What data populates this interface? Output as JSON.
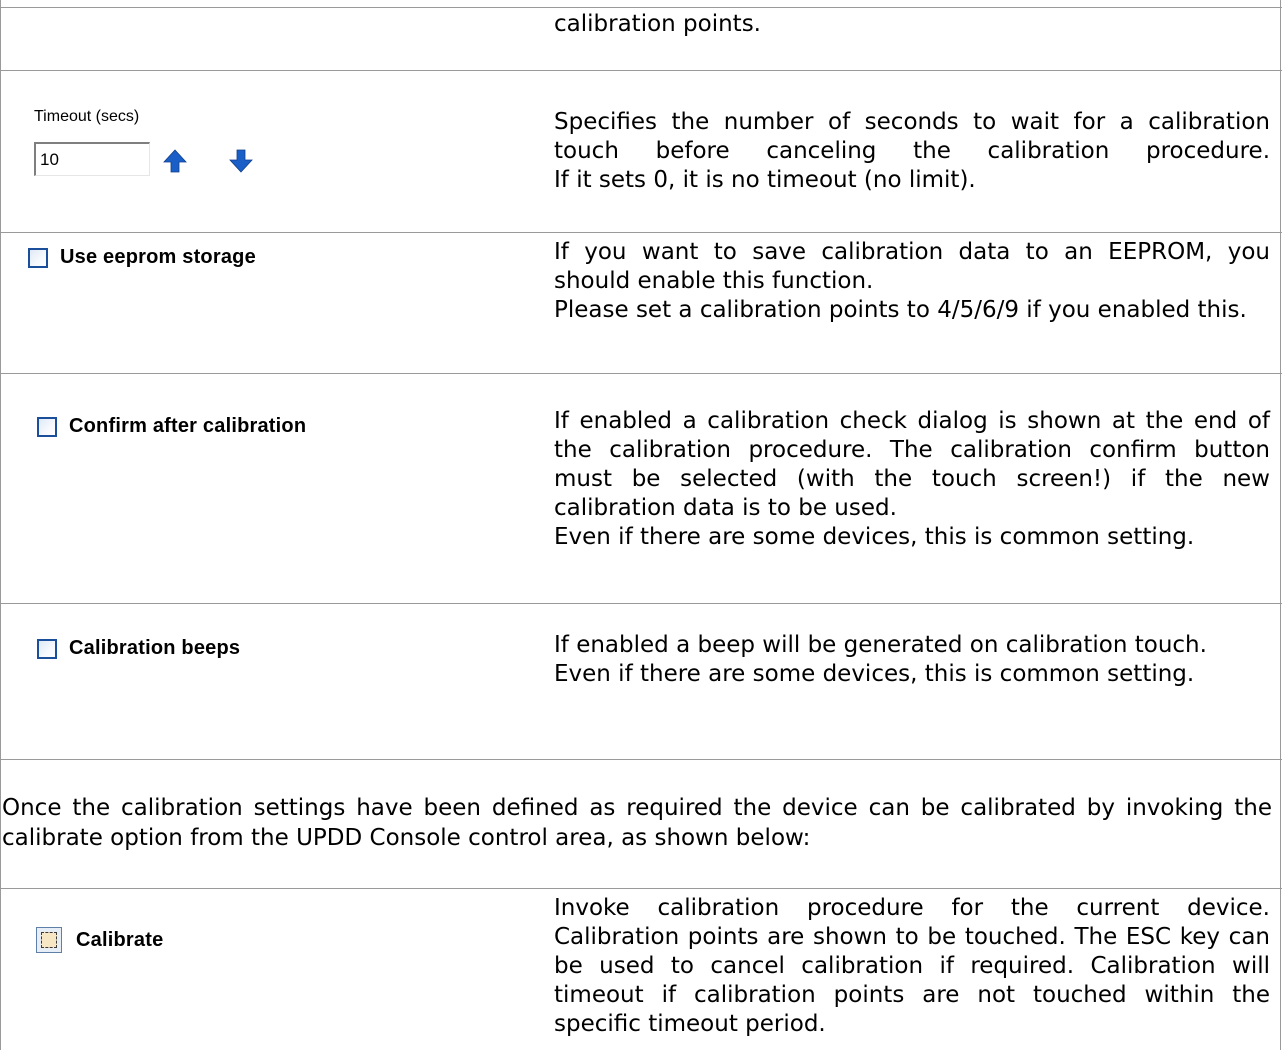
{
  "rows": {
    "top": {
      "description": "calibration points."
    },
    "timeout": {
      "label": "Timeout (secs)",
      "value": "10",
      "up_icon": "arrow-up-icon",
      "down_icon": "arrow-down-icon",
      "description_lines": [
        "Specifies the number of seconds to wait for a calibration touch before canceling the calibration procedure.",
        "If it sets 0, it is no timeout (no limit)."
      ]
    },
    "eeprom": {
      "label": "Use eeprom storage",
      "checked": false,
      "description_lines": [
        "If you want to save calibration data to an EEPROM, you should enable this function.",
        "Please set a calibration points to 4/5/6/9 if you enabled this."
      ]
    },
    "confirm": {
      "label": "Confirm after calibration",
      "checked": false,
      "description_lines": [
        "If enabled a calibration check dialog is shown at the end of the calibration procedure. The calibration confirm button must be selected (with the touch screen!) if the new calibration data is to be used.",
        "Even if there are some devices, this is common setting."
      ]
    },
    "beeps": {
      "label": "Calibration beeps",
      "checked": false,
      "description_lines": [
        "If enabled a beep will be generated on calibration touch.",
        "Even if there are some devices, this is common setting."
      ]
    },
    "intro": {
      "text": "Once the calibration settings have been defined as required the device can be calibrated by invoking the calibrate option from the UPDD Console control area, as shown below:"
    },
    "calibrate": {
      "label": "Calibrate",
      "icon": "calibrate-icon",
      "description": "Invoke calibration procedure for the current device. Calibration points are shown to be touched. The ESC key can be used to cancel calibration if required. Calibration will timeout if calibration points are not touched within the specific timeout period."
    }
  },
  "colors": {
    "rule": "#9a9a9a",
    "checkbox_border": "#1b4f9c",
    "arrow_blue": "#1a5fc7"
  }
}
